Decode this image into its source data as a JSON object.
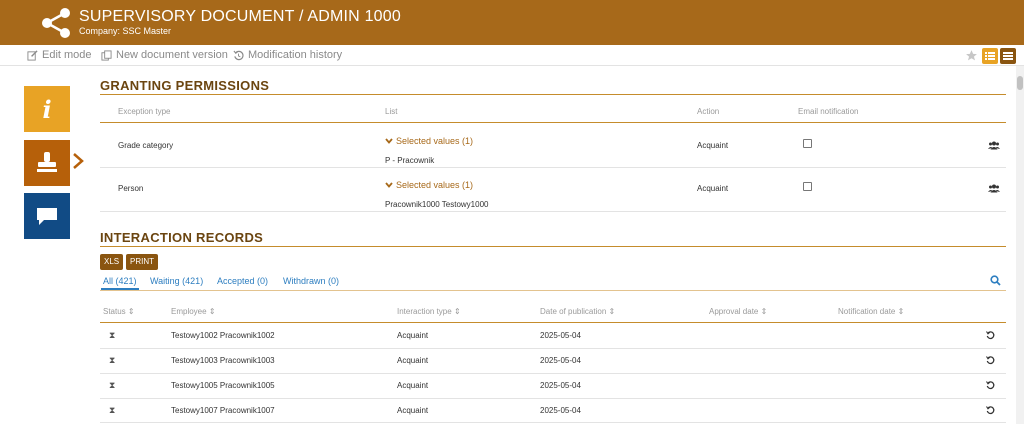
{
  "header": {
    "title": "SUPERVISORY DOCUMENT / ADMIN 1000",
    "company": "Company: SSC Master",
    "brand_color": "#a7691a"
  },
  "toolbar": {
    "edit_mode": "Edit mode",
    "new_version": "New document version",
    "history": "Modification history"
  },
  "permissions": {
    "title": "GRANTING PERMISSIONS",
    "columns": [
      "Exception type",
      "List",
      "Action",
      "Email notification"
    ],
    "rows": [
      {
        "exception_type": "Grade category",
        "selected": "Selected values (1)",
        "value": "P - Pracownik",
        "action": "Acquaint",
        "email": false
      },
      {
        "exception_type": "Person",
        "selected": "Selected values (1)",
        "value": "Pracownik1000 Testowy1000",
        "action": "Acquaint",
        "email": false
      }
    ]
  },
  "interaction": {
    "title": "INTERACTION RECORDS",
    "xls_label": "XLS",
    "print_label": "PRINT",
    "tabs": [
      "All (421)",
      "Waiting (421)",
      "Accepted (0)",
      "Withdrawn (0)"
    ],
    "columns": [
      "Status",
      "Employee",
      "Interaction type",
      "Date of publication",
      "Approval date",
      "Notification date"
    ],
    "rows": [
      {
        "employee": "Testowy1002 Pracownik1002",
        "type": "Acquaint",
        "date": "2025-05-04"
      },
      {
        "employee": "Testowy1003 Pracownik1003",
        "type": "Acquaint",
        "date": "2025-05-04"
      },
      {
        "employee": "Testowy1005 Pracownik1005",
        "type": "Acquaint",
        "date": "2025-05-04"
      },
      {
        "employee": "Testowy1007 Pracownik1007",
        "type": "Acquaint",
        "date": "2025-05-04"
      }
    ]
  }
}
